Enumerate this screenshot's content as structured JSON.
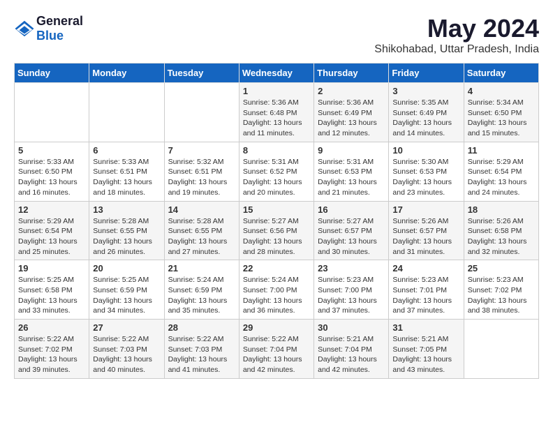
{
  "logo": {
    "text_general": "General",
    "text_blue": "Blue"
  },
  "title": "May 2024",
  "subtitle": "Shikohabad, Uttar Pradesh, India",
  "days_of_week": [
    "Sunday",
    "Monday",
    "Tuesday",
    "Wednesday",
    "Thursday",
    "Friday",
    "Saturday"
  ],
  "weeks": [
    [
      {
        "day": "",
        "info": ""
      },
      {
        "day": "",
        "info": ""
      },
      {
        "day": "",
        "info": ""
      },
      {
        "day": "1",
        "info": "Sunrise: 5:36 AM\nSunset: 6:48 PM\nDaylight: 13 hours\nand 11 minutes."
      },
      {
        "day": "2",
        "info": "Sunrise: 5:36 AM\nSunset: 6:49 PM\nDaylight: 13 hours\nand 12 minutes."
      },
      {
        "day": "3",
        "info": "Sunrise: 5:35 AM\nSunset: 6:49 PM\nDaylight: 13 hours\nand 14 minutes."
      },
      {
        "day": "4",
        "info": "Sunrise: 5:34 AM\nSunset: 6:50 PM\nDaylight: 13 hours\nand 15 minutes."
      }
    ],
    [
      {
        "day": "5",
        "info": "Sunrise: 5:33 AM\nSunset: 6:50 PM\nDaylight: 13 hours\nand 16 minutes."
      },
      {
        "day": "6",
        "info": "Sunrise: 5:33 AM\nSunset: 6:51 PM\nDaylight: 13 hours\nand 18 minutes."
      },
      {
        "day": "7",
        "info": "Sunrise: 5:32 AM\nSunset: 6:51 PM\nDaylight: 13 hours\nand 19 minutes."
      },
      {
        "day": "8",
        "info": "Sunrise: 5:31 AM\nSunset: 6:52 PM\nDaylight: 13 hours\nand 20 minutes."
      },
      {
        "day": "9",
        "info": "Sunrise: 5:31 AM\nSunset: 6:53 PM\nDaylight: 13 hours\nand 21 minutes."
      },
      {
        "day": "10",
        "info": "Sunrise: 5:30 AM\nSunset: 6:53 PM\nDaylight: 13 hours\nand 23 minutes."
      },
      {
        "day": "11",
        "info": "Sunrise: 5:29 AM\nSunset: 6:54 PM\nDaylight: 13 hours\nand 24 minutes."
      }
    ],
    [
      {
        "day": "12",
        "info": "Sunrise: 5:29 AM\nSunset: 6:54 PM\nDaylight: 13 hours\nand 25 minutes."
      },
      {
        "day": "13",
        "info": "Sunrise: 5:28 AM\nSunset: 6:55 PM\nDaylight: 13 hours\nand 26 minutes."
      },
      {
        "day": "14",
        "info": "Sunrise: 5:28 AM\nSunset: 6:55 PM\nDaylight: 13 hours\nand 27 minutes."
      },
      {
        "day": "15",
        "info": "Sunrise: 5:27 AM\nSunset: 6:56 PM\nDaylight: 13 hours\nand 28 minutes."
      },
      {
        "day": "16",
        "info": "Sunrise: 5:27 AM\nSunset: 6:57 PM\nDaylight: 13 hours\nand 30 minutes."
      },
      {
        "day": "17",
        "info": "Sunrise: 5:26 AM\nSunset: 6:57 PM\nDaylight: 13 hours\nand 31 minutes."
      },
      {
        "day": "18",
        "info": "Sunrise: 5:26 AM\nSunset: 6:58 PM\nDaylight: 13 hours\nand 32 minutes."
      }
    ],
    [
      {
        "day": "19",
        "info": "Sunrise: 5:25 AM\nSunset: 6:58 PM\nDaylight: 13 hours\nand 33 minutes."
      },
      {
        "day": "20",
        "info": "Sunrise: 5:25 AM\nSunset: 6:59 PM\nDaylight: 13 hours\nand 34 minutes."
      },
      {
        "day": "21",
        "info": "Sunrise: 5:24 AM\nSunset: 6:59 PM\nDaylight: 13 hours\nand 35 minutes."
      },
      {
        "day": "22",
        "info": "Sunrise: 5:24 AM\nSunset: 7:00 PM\nDaylight: 13 hours\nand 36 minutes."
      },
      {
        "day": "23",
        "info": "Sunrise: 5:23 AM\nSunset: 7:00 PM\nDaylight: 13 hours\nand 37 minutes."
      },
      {
        "day": "24",
        "info": "Sunrise: 5:23 AM\nSunset: 7:01 PM\nDaylight: 13 hours\nand 37 minutes."
      },
      {
        "day": "25",
        "info": "Sunrise: 5:23 AM\nSunset: 7:02 PM\nDaylight: 13 hours\nand 38 minutes."
      }
    ],
    [
      {
        "day": "26",
        "info": "Sunrise: 5:22 AM\nSunset: 7:02 PM\nDaylight: 13 hours\nand 39 minutes."
      },
      {
        "day": "27",
        "info": "Sunrise: 5:22 AM\nSunset: 7:03 PM\nDaylight: 13 hours\nand 40 minutes."
      },
      {
        "day": "28",
        "info": "Sunrise: 5:22 AM\nSunset: 7:03 PM\nDaylight: 13 hours\nand 41 minutes."
      },
      {
        "day": "29",
        "info": "Sunrise: 5:22 AM\nSunset: 7:04 PM\nDaylight: 13 hours\nand 42 minutes."
      },
      {
        "day": "30",
        "info": "Sunrise: 5:21 AM\nSunset: 7:04 PM\nDaylight: 13 hours\nand 42 minutes."
      },
      {
        "day": "31",
        "info": "Sunrise: 5:21 AM\nSunset: 7:05 PM\nDaylight: 13 hours\nand 43 minutes."
      },
      {
        "day": "",
        "info": ""
      }
    ]
  ]
}
